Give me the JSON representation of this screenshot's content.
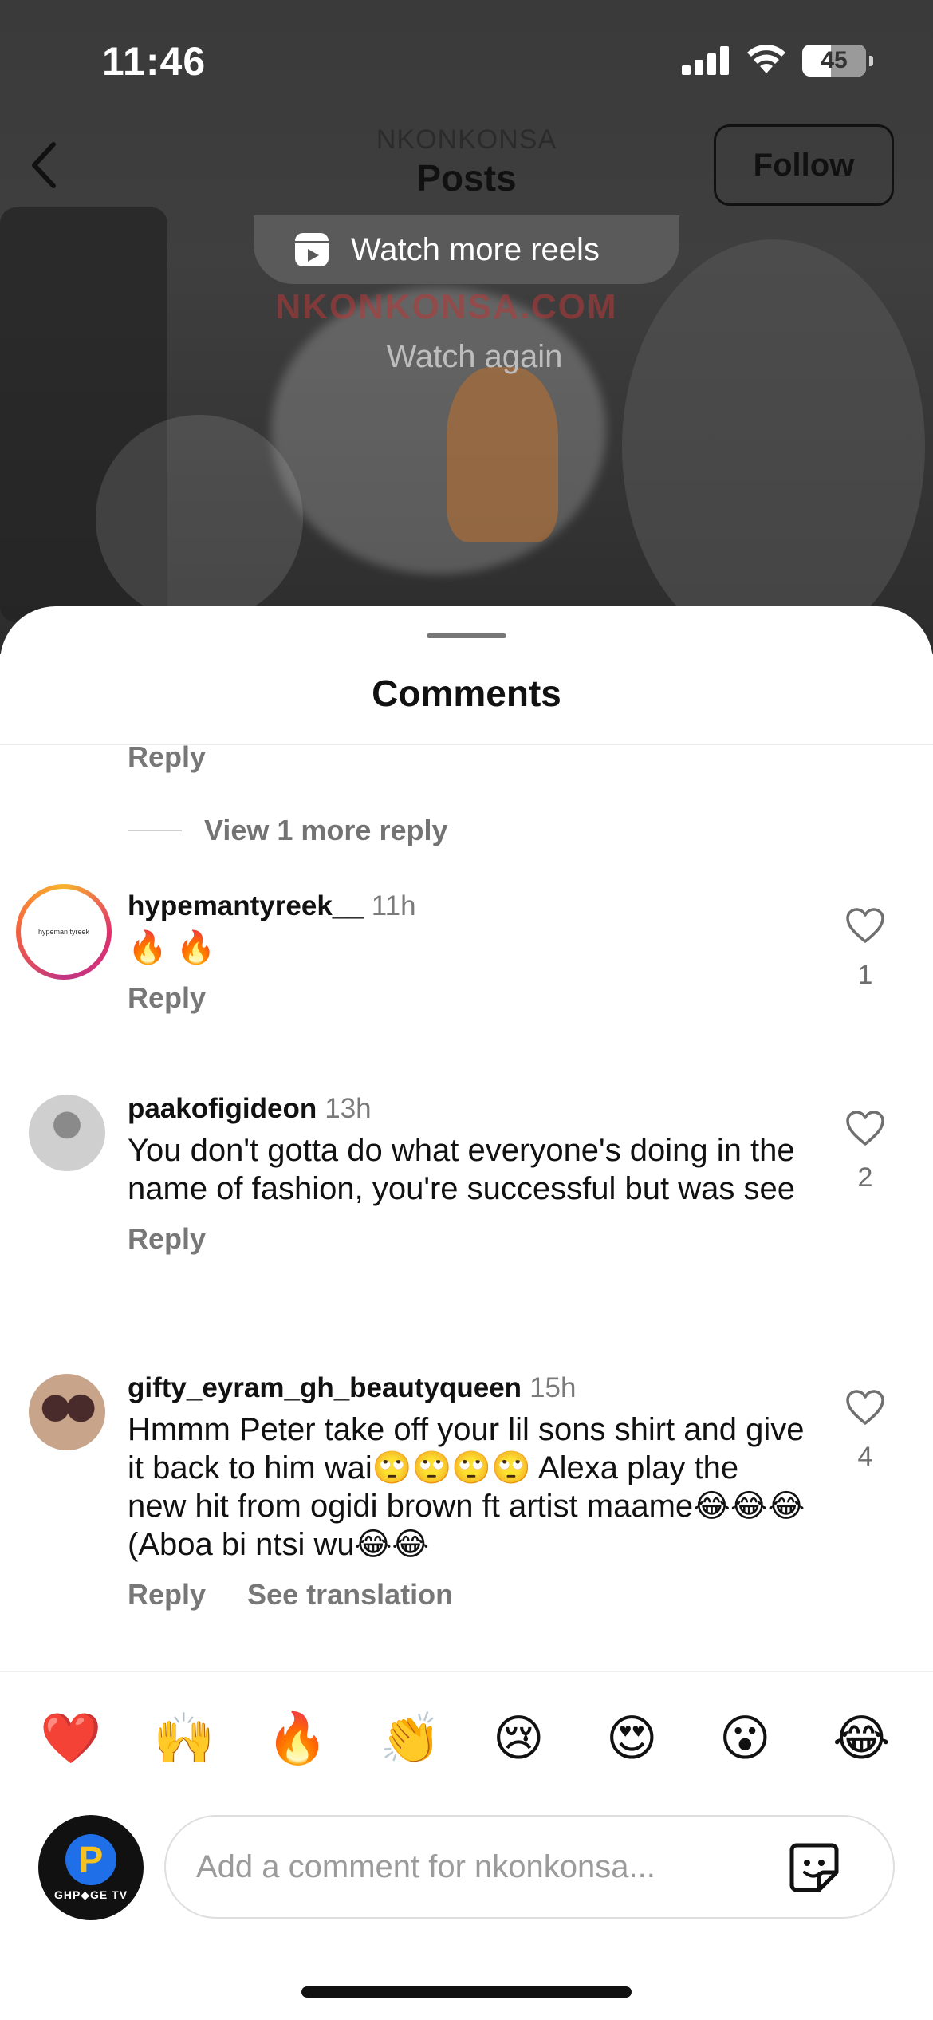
{
  "status_bar": {
    "time": "11:46",
    "battery": "45"
  },
  "header": {
    "account": "NKONKONSA",
    "title": "Posts",
    "follow_label": "Follow"
  },
  "video": {
    "watch_more_reels": "Watch more reels",
    "watermark": "NKONKONSA.COM",
    "watch_again": "Watch again"
  },
  "sheet": {
    "title": "Comments",
    "partial_reply": "Reply",
    "view_more_replies": "View 1 more reply",
    "comments": [
      {
        "username": "hypemantyreek__",
        "time": "11h",
        "text": "🔥 🔥",
        "reply": "Reply",
        "likes": "1",
        "avatar_text": "hypeman tyreek"
      },
      {
        "username": "paakofigideon",
        "time": "13h",
        "text": "You don't gotta do what everyone's doing in the name of fashion, you're successful but was see",
        "reply": "Reply",
        "likes": "2"
      },
      {
        "username": "gifty_eyram_gh_beautyqueen",
        "time": "15h",
        "text": "Hmmm Peter take off your lil sons shirt and give it back to him wai🙄🙄🙄🙄 Alexa play the new hit from ogidi brown ft artist maame😂😂😂 (Aboa bi ntsi wu😂😂",
        "reply": "Reply",
        "see_translation": "See translation",
        "likes": "4"
      }
    ]
  },
  "emoji_bar": [
    "❤️",
    "🙌",
    "🔥",
    "👏",
    "😢",
    "😍",
    "😮",
    "😂"
  ],
  "composer": {
    "placeholder": "Add a comment for nkonkonsa...",
    "avatar_logo": "GHP◆GE TV"
  },
  "icons": {
    "back": "chevron-left-icon",
    "like": "heart-outline-icon",
    "sticker": "sticker-icon",
    "reels": "reels-icon"
  }
}
